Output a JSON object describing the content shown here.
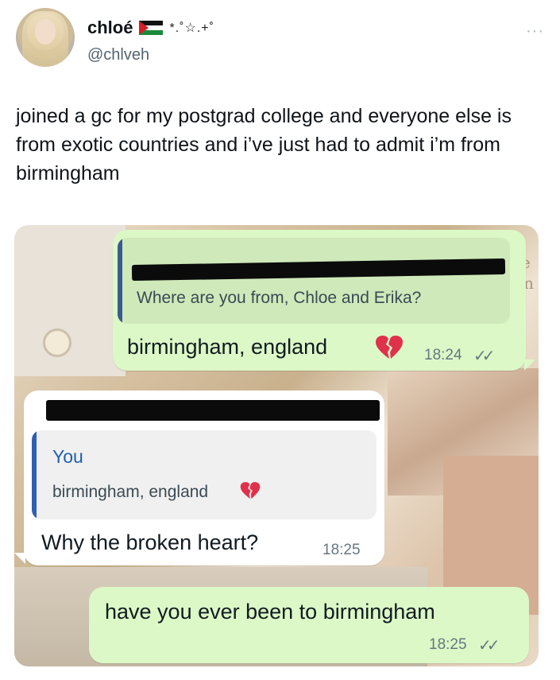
{
  "tweet": {
    "display_name": "chloé",
    "name_decoration": "*.˚☆.+˚",
    "handle": "@chlveh",
    "more": "···",
    "text": "joined a gc for my postgrad college and everyone else is from exotic countries and i’ve just had to admit i’m from birmingham"
  },
  "chat": {
    "msg1": {
      "quoted_text": "Where are you from, Chloe and Erika?",
      "text": "birmingham, england",
      "time": "18:24",
      "ticks": "✓✓"
    },
    "msg2": {
      "quoted_sender": "You",
      "quoted_text": "birmingham, england",
      "text": "Why the broken heart?",
      "time": "18:25"
    },
    "msg3": {
      "text": "have you ever been to birmingham",
      "time": "18:25",
      "ticks": "✓✓"
    },
    "background_text": "a\ntie\nvin"
  },
  "colors": {
    "outgoing_bubble": "#dcf8c6",
    "incoming_bubble": "#ffffff",
    "quote_bar_outgoing": "#3b5a8f",
    "quote_bar_incoming": "#2f5fb3",
    "you_label": "#1f5fb0",
    "broken_heart": "#e0314b"
  }
}
